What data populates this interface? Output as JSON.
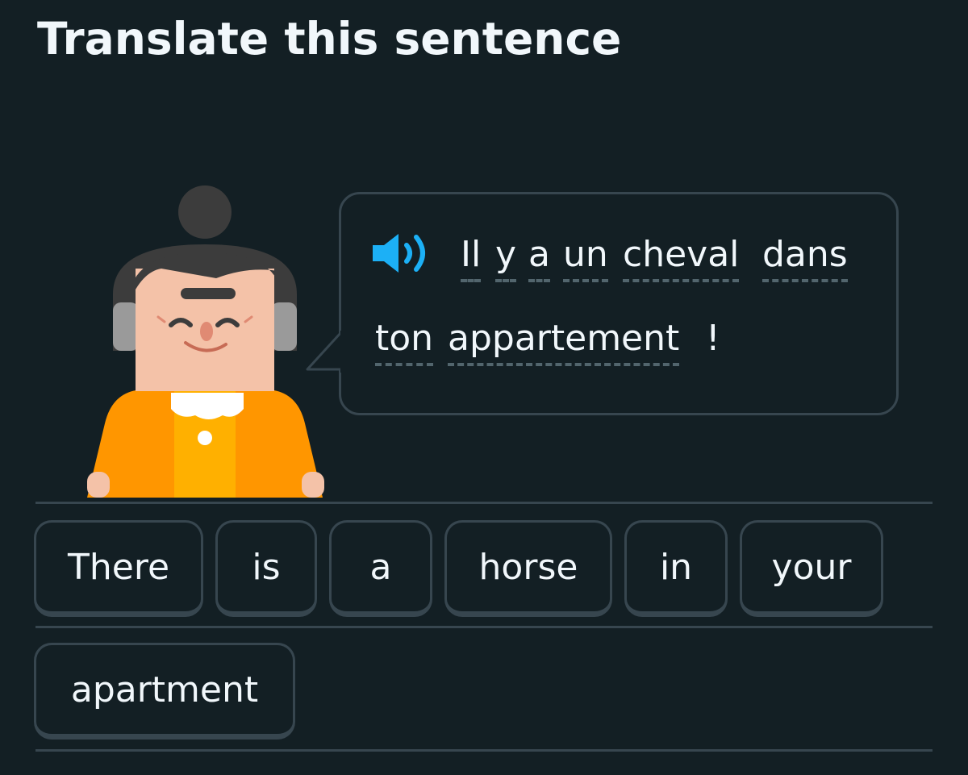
{
  "header": {
    "title": "Translate this sentence"
  },
  "prompt": {
    "speaker_icon": "speaker-icon",
    "words": [
      "Il",
      "y",
      "a",
      "un",
      "cheval",
      "dans",
      "ton",
      "appartement",
      "!"
    ]
  },
  "word_bank": {
    "tiles": [
      "There",
      "is",
      "a",
      "horse",
      "in",
      "your",
      "apartment"
    ]
  },
  "colors": {
    "background": "#131f24",
    "border": "#37464f",
    "text": "#f1f7fb",
    "speaker": "#1cb0f6",
    "shirt": "#ff9600"
  }
}
